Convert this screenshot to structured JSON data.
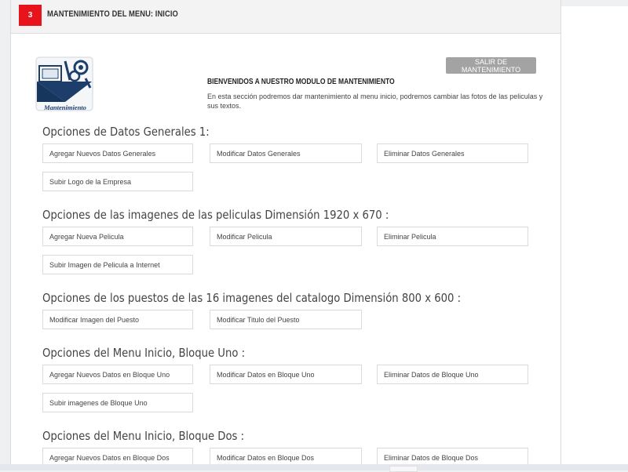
{
  "header": {
    "step": "3",
    "title": "MANTENIMIENTO DEL MENU: INICIO"
  },
  "logo": {
    "caption": "Mantenimiento",
    "icon": "maintenance-tools-icon"
  },
  "exit_button": "SALIR DE MANTENIMIENTO",
  "welcome": {
    "title": "BIENVENIDOS A NUESTRO MODULO DE MANTENIMIENTO",
    "text": "En esta sección podremos dar mantenimiento al menu inicio, podremos cambiar las fotos de las peliculas y sus textos."
  },
  "sections": [
    {
      "title": "Opciones de Datos Generales 1:",
      "options": [
        "Agregar Nuevos Datos Generales",
        "Modificar Datos Generales",
        "Eliminar Datos Generales",
        "Subir Logo de la Empresa"
      ]
    },
    {
      "title": "Opciones de las imagenes de las peliculas Dimensión 1920 x 670 :",
      "options": [
        "Agregar Nueva Pelicula",
        "Modificar Pelicula",
        "Eliminar Pelicula",
        "Subir Imagen de Pelicula a Internet"
      ]
    },
    {
      "title": "Opciones de los puestos de las 16 imagenes del catalogo Dimensión 800 x 600 :",
      "options": [
        "Modificar Imagen del Puesto",
        "Modificar Titulo del Puesto"
      ]
    },
    {
      "title": "Opciones del Menu Inicio, Bloque Uno :",
      "options": [
        "Agregar Nuevos Datos en Bloque Uno",
        "Modificar Datos en Bloque Uno",
        "Eliminar Datos de Bloque Uno",
        "Subir imagenes de Bloque Uno"
      ]
    },
    {
      "title": "Opciones del Menu Inicio, Bloque Dos :",
      "options": [
        "Agregar Nuevos Datos en Bloque Dos",
        "Modificar Datos en Bloque Dos",
        "Eliminar Datos de Bloque Dos"
      ]
    }
  ],
  "colors": {
    "badge": "#e8141b",
    "exit_button": "#a3a3a3"
  }
}
